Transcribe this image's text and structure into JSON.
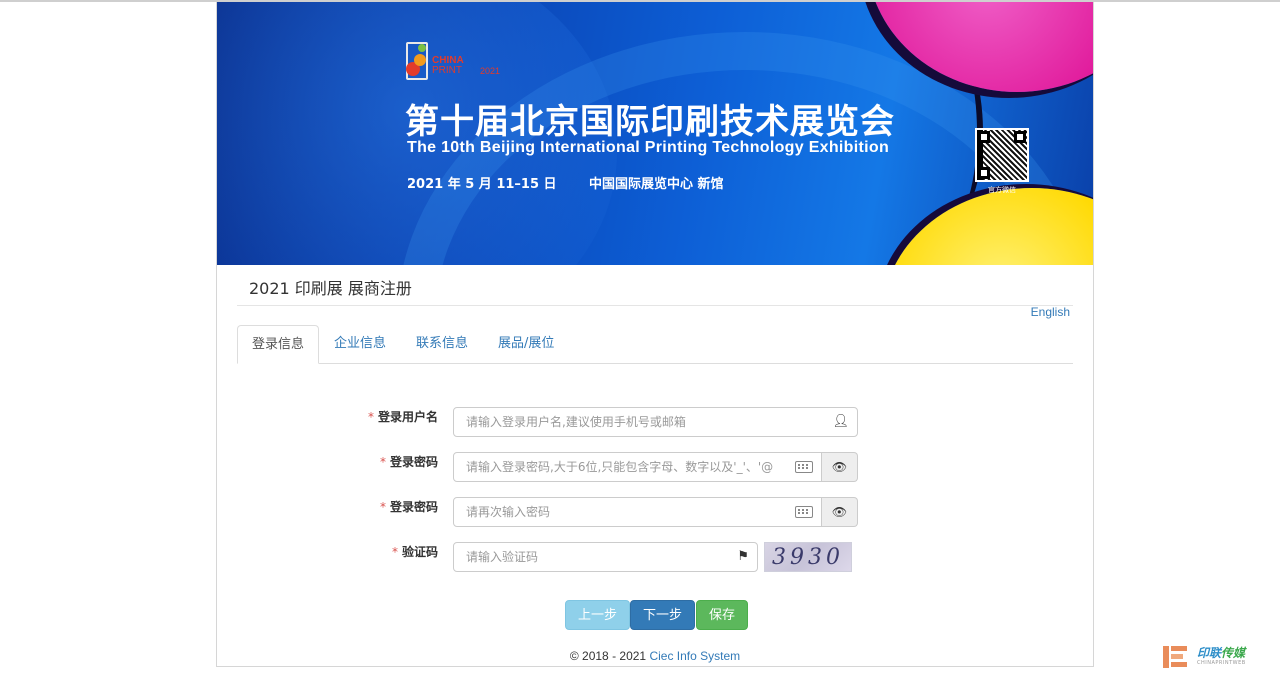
{
  "banner": {
    "logo_line1": "CHINA",
    "logo_line2": "PRINT",
    "logo_year": "2021",
    "title_cn": "第十届北京国际印刷技术展览会",
    "title_en": "The 10th Beijing International Printing Technology Exhibition",
    "date": "2021 年 5 月 11–15 日",
    "venue": "中国国际展览中心   新馆",
    "qr_label": "官方微信"
  },
  "page": {
    "title": "2021 印刷展 展商注册",
    "language_link": "English"
  },
  "tabs": [
    {
      "label": "登录信息",
      "active": true
    },
    {
      "label": "企业信息",
      "active": false
    },
    {
      "label": "联系信息",
      "active": false
    },
    {
      "label": "展品/展位",
      "active": false
    }
  ],
  "form": {
    "required_mark": "*",
    "username": {
      "label": "登录用户名",
      "placeholder": "请输入登录用户名,建议使用手机号或邮箱",
      "icon": "user-icon"
    },
    "password": {
      "label": "登录密码",
      "placeholder": "请输入登录密码,大于6位,只能包含字母、数字以及'_'、'@",
      "icon": "keyboard-icon",
      "toggle_icon": "eye-icon"
    },
    "password_confirm": {
      "label": "登录密码",
      "placeholder": "请再次输入密码",
      "icon": "keyboard-icon",
      "toggle_icon": "eye-icon"
    },
    "captcha": {
      "label": "验证码",
      "placeholder": "请输入验证码",
      "icon": "flag-icon",
      "image_text": "3930"
    }
  },
  "buttons": {
    "prev": "上一步",
    "next": "下一步",
    "save": "保存"
  },
  "footer": {
    "copyright": "© 2018 - 2021 ",
    "link": "Ciec Info System"
  },
  "watermark": {
    "text_a": "印联",
    "text_b": "传媒",
    "sub": "CHINAPRINTWEB"
  }
}
